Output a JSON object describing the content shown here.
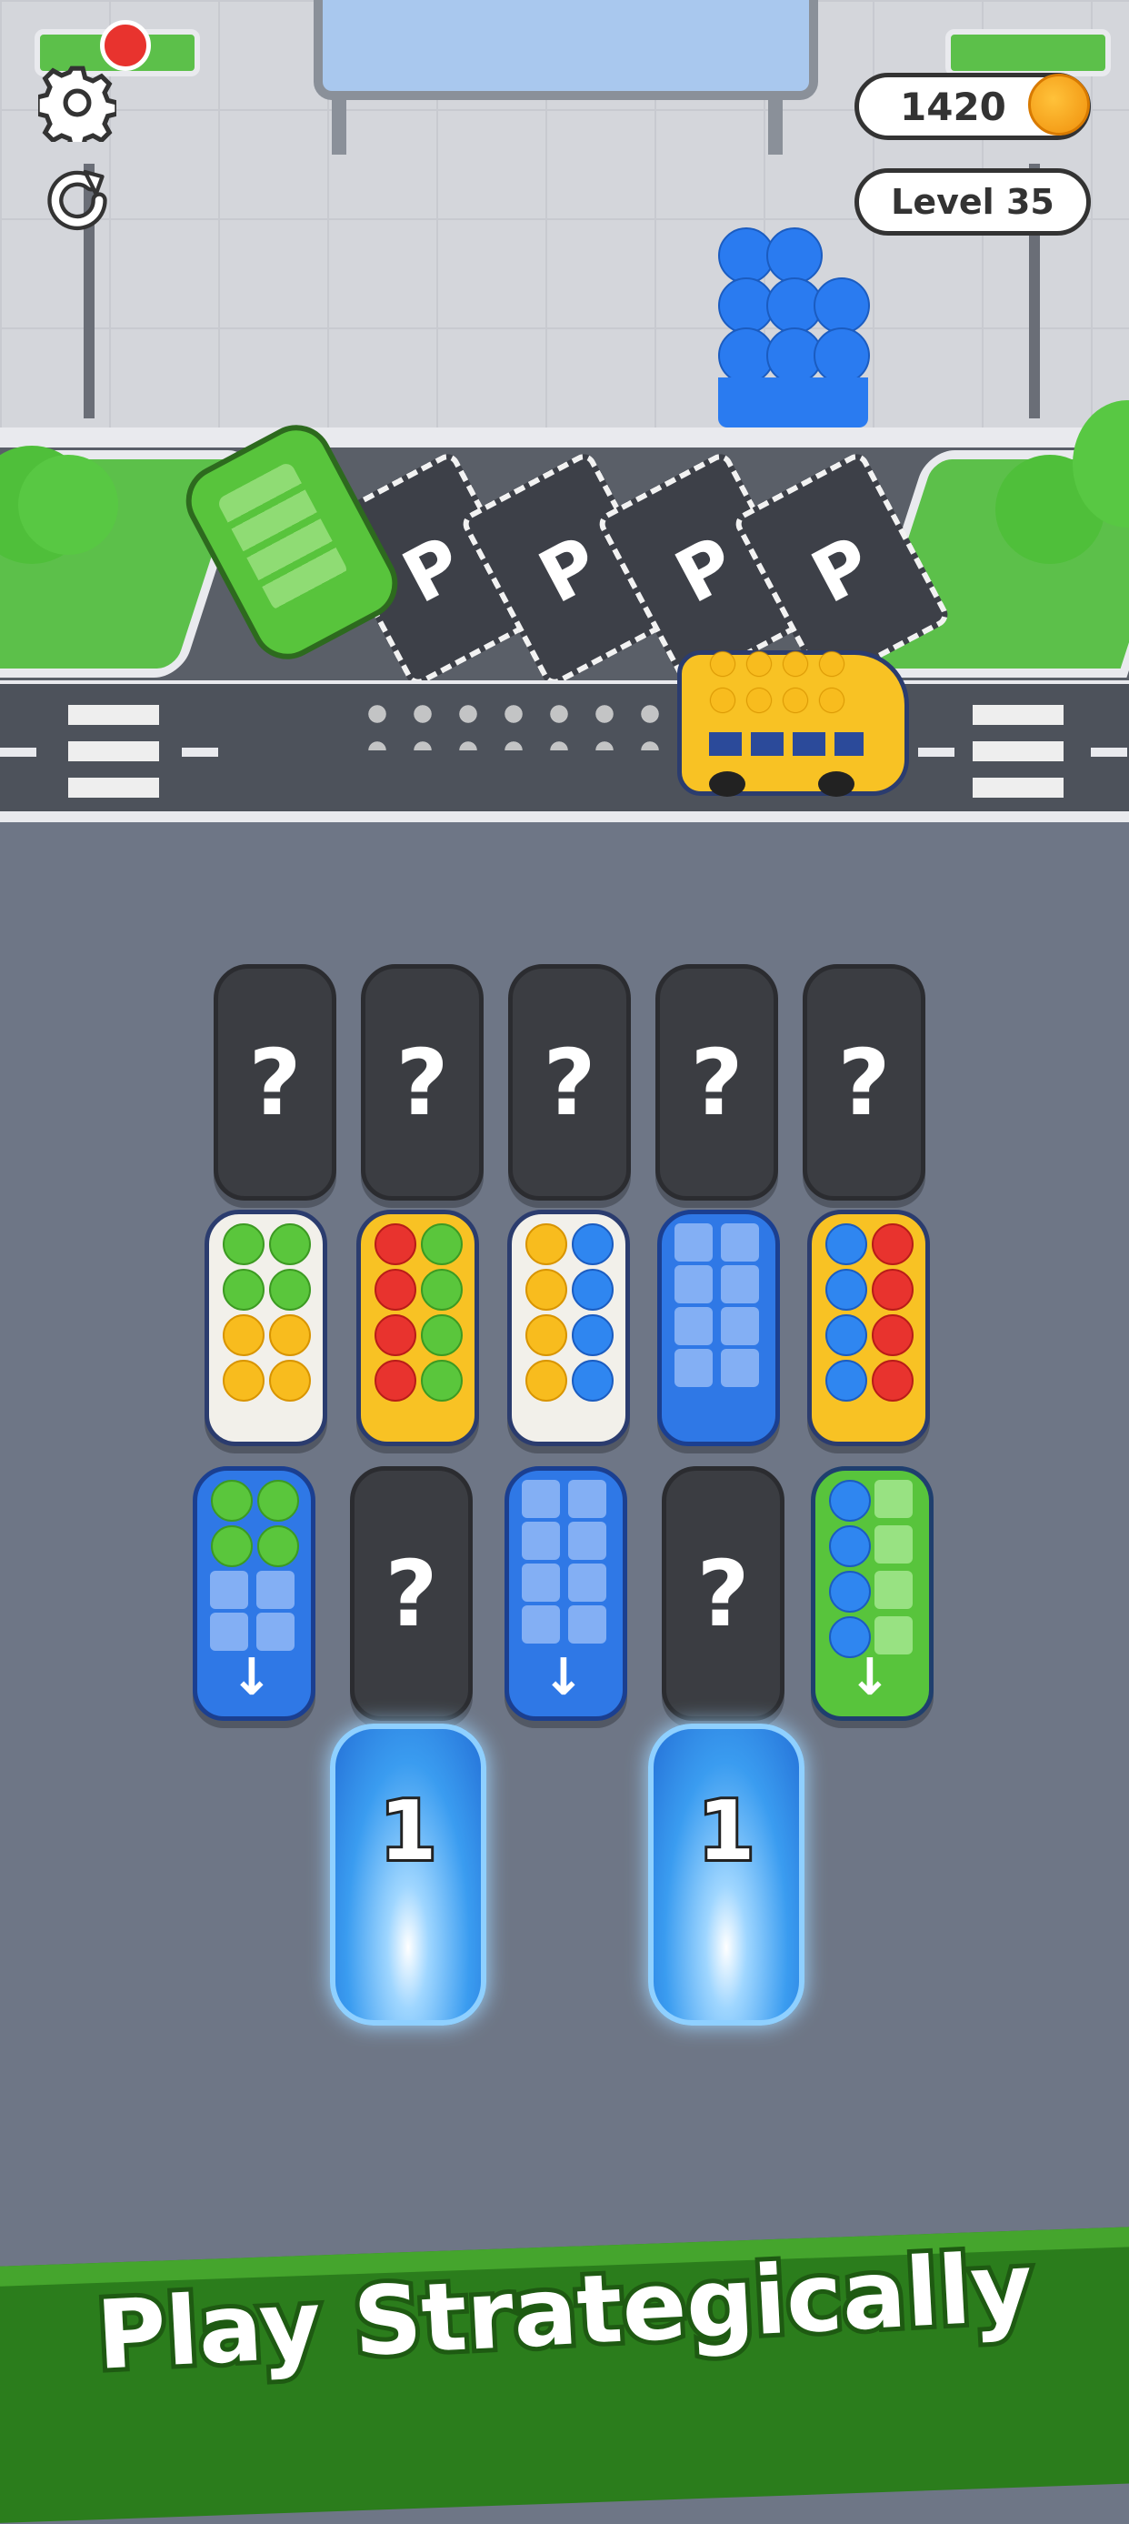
{
  "hud": {
    "coins": "1420",
    "coin_icon": "coin-icon",
    "level": "Level 35",
    "settings_icon": "gear-icon",
    "restart_icon": "restart-icon"
  },
  "parking": {
    "slot_label": "P",
    "slots": [
      "P",
      "P",
      "P",
      "P"
    ]
  },
  "board": {
    "mystery_label": "?",
    "frozen_counts": [
      "1",
      "1"
    ]
  },
  "colors": {
    "green": "#5ac63c",
    "yellow": "#f8bc1e",
    "red": "#e8332e",
    "blue": "#2f86f0"
  },
  "banner": {
    "text": "Play Strategically"
  }
}
